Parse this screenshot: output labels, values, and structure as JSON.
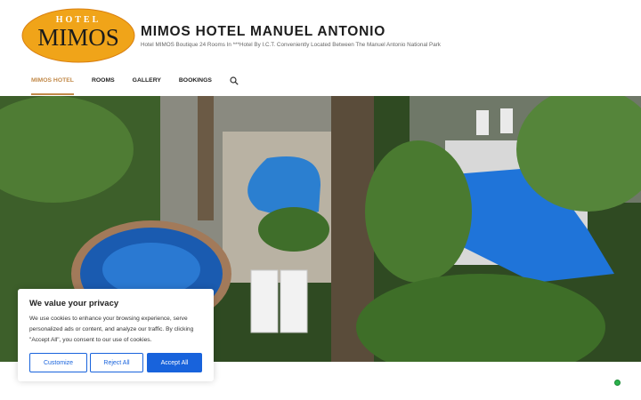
{
  "logo": {
    "top_text": "HOTEL",
    "main_text": "MIMOS"
  },
  "site": {
    "title": "MIMOS HOTEL MANUEL ANTONIO",
    "tagline": "Hotel MIMOS Boutique 24 Rooms In ***Hotel By I.C.T. Conveniently Located Between The Manuel Antonio National Park"
  },
  "nav": {
    "items": [
      {
        "label": "MIMOS HOTEL",
        "active": true
      },
      {
        "label": "ROOMS",
        "active": false
      },
      {
        "label": "GALLERY",
        "active": false
      },
      {
        "label": "BOOKINGS",
        "active": false
      }
    ],
    "search_icon": "search-icon"
  },
  "cookie": {
    "title": "We value your privacy",
    "text": "We use cookies to enhance your browsing experience, serve personalized ads or content, and analyze our traffic. By clicking \"Accept All\", you consent to our use of cookies.",
    "customize_label": "Customize",
    "reject_label": "Reject All",
    "accept_label": "Accept All"
  },
  "colors": {
    "accent": "#c28a4a",
    "button": "#1863dc",
    "status": "#2bb24c"
  }
}
